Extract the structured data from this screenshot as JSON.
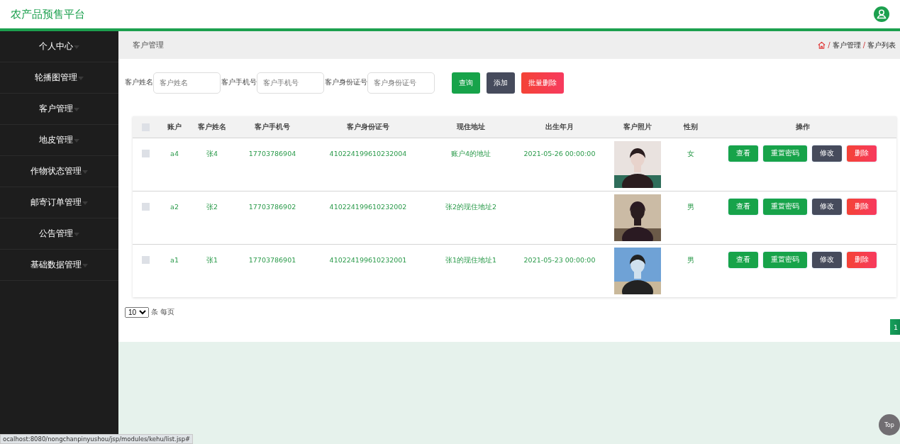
{
  "header": {
    "title": "农产品预售平台"
  },
  "sidebar": {
    "items": [
      {
        "label": "个人中心",
        "selected": false
      },
      {
        "label": "轮播图管理",
        "selected": false
      },
      {
        "label": "客户管理",
        "selected": false
      },
      {
        "label": "地皮管理",
        "selected": false
      },
      {
        "label": "作物状态管理",
        "selected": false
      },
      {
        "label": "邮寄订单管理",
        "selected": false
      },
      {
        "label": "公告管理",
        "selected": false
      },
      {
        "label": "基础数据管理",
        "selected": false
      }
    ]
  },
  "page_title": "客户管理",
  "breadcrumb": [
    {
      "separator": "/",
      "label": "客户管理"
    },
    {
      "separator": "/",
      "label": "客户列表"
    }
  ],
  "search": {
    "fields": [
      {
        "label": "客户姓名",
        "placeholder": "客户姓名"
      },
      {
        "label": "客户手机号",
        "placeholder": "客户手机号"
      },
      {
        "label": "客户身份证号",
        "placeholder": "客户身份证号"
      }
    ],
    "buttons": [
      {
        "label": "查询",
        "kind": "query"
      },
      {
        "label": "添加",
        "kind": "add"
      },
      {
        "label": "批量删除",
        "kind": "delete"
      }
    ]
  },
  "table": {
    "all_checked": false,
    "columns": [
      "账户",
      "客户姓名",
      "客户手机号",
      "客户身份证号",
      "现住地址",
      "出生年月",
      "客户照片",
      "性别",
      "操作"
    ],
    "rows": [
      {
        "checked": false,
        "cells": [
          "a4",
          "张4",
          "17703786904",
          "410224199610232004",
          "账户4的地址",
          "2021-05-26 00:00:00"
        ],
        "gender": "女",
        "actions": [
          {
            "label": "查看",
            "kind": "view"
          },
          {
            "label": "重置密码",
            "kind": "reset"
          },
          {
            "label": "修改",
            "kind": "edit"
          },
          {
            "label": "删除",
            "kind": "delete"
          }
        ]
      },
      {
        "checked": false,
        "cells": [
          "a2",
          "张2",
          "17703786902",
          "410224199610232002",
          "张2的现住地址2",
          ""
        ],
        "gender": "男",
        "actions": [
          {
            "label": "查看",
            "kind": "view"
          },
          {
            "label": "重置密码",
            "kind": "reset"
          },
          {
            "label": "修改",
            "kind": "edit"
          },
          {
            "label": "删除",
            "kind": "delete"
          }
        ]
      },
      {
        "checked": false,
        "cells": [
          "a1",
          "张1",
          "17703786901",
          "410224199610232001",
          "张1的现住地址1",
          "2021-05-23 00:00:00"
        ],
        "gender": "男",
        "actions": [
          {
            "label": "查看",
            "kind": "view"
          },
          {
            "label": "重置密码",
            "kind": "reset"
          },
          {
            "label": "修改",
            "kind": "edit"
          },
          {
            "label": "删除",
            "kind": "delete"
          }
        ]
      }
    ]
  },
  "pagination": {
    "page_size": "10",
    "page_size_label": "条 每页",
    "pages": [
      {
        "label": "1",
        "selected": true
      }
    ]
  },
  "back_to_top": "Top",
  "status_bar": "ocalhost:8080/nongchanpinyushou/jsp/modules/kehu/list.jsp#"
}
